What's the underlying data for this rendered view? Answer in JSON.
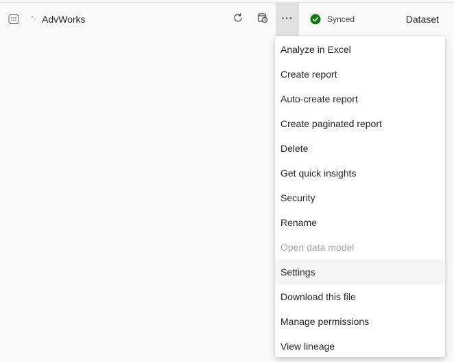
{
  "dataset": {
    "name": "AdvWorks",
    "type_label": "Dataset",
    "type_icon": "dataset-grid-icon",
    "sparkle_icon": "sparkle-icon"
  },
  "toolbar": {
    "refresh_icon": "refresh-icon",
    "schedule_icon": "scheduled-refresh-icon",
    "more_label": "···"
  },
  "status": {
    "text": "Synced",
    "icon": "checkmark-circle-icon",
    "color": "#107c10"
  },
  "menu": {
    "items": [
      {
        "label": "Analyze in Excel",
        "state": "normal"
      },
      {
        "label": "Create report",
        "state": "normal"
      },
      {
        "label": "Auto-create report",
        "state": "normal"
      },
      {
        "label": "Create paginated report",
        "state": "normal"
      },
      {
        "label": "Delete",
        "state": "normal"
      },
      {
        "label": "Get quick insights",
        "state": "normal"
      },
      {
        "label": "Security",
        "state": "normal"
      },
      {
        "label": "Rename",
        "state": "normal"
      },
      {
        "label": "Open data model",
        "state": "disabled"
      },
      {
        "label": "Settings",
        "state": "hover"
      },
      {
        "label": "Download this file",
        "state": "normal"
      },
      {
        "label": "Manage permissions",
        "state": "normal"
      },
      {
        "label": "View lineage",
        "state": "normal"
      }
    ]
  }
}
